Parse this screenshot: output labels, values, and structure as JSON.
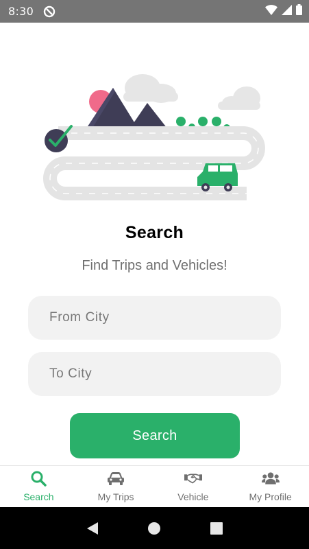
{
  "status_bar": {
    "time": "8:30",
    "icons": [
      "app-notification-icon",
      "wifi-icon",
      "cellular-signal-icon",
      "battery-icon"
    ]
  },
  "main": {
    "title": "Search",
    "subtitle": "Find Trips and Vehicles!",
    "from_field": {
      "placeholder": "From City",
      "value": ""
    },
    "to_field": {
      "placeholder": "To City",
      "value": ""
    },
    "search_button_label": "Search"
  },
  "bottom_nav": {
    "items": [
      {
        "label": "Search",
        "icon": "search-icon",
        "active": true
      },
      {
        "label": "My Trips",
        "icon": "car-icon",
        "active": false
      },
      {
        "label": "Vehicle",
        "icon": "handshake-icon",
        "active": false
      },
      {
        "label": "My Profile",
        "icon": "users-icon",
        "active": false
      }
    ]
  },
  "system_nav": {
    "icons": [
      "back-icon",
      "home-icon",
      "recents-icon"
    ]
  },
  "colors": {
    "accent": "#2ab06a",
    "status_bar": "#757575",
    "field_background": "#f2f2f2",
    "inactive_text": "#6f6f6f",
    "mountain": "#3f3d56",
    "sun": "#f06a8a"
  }
}
